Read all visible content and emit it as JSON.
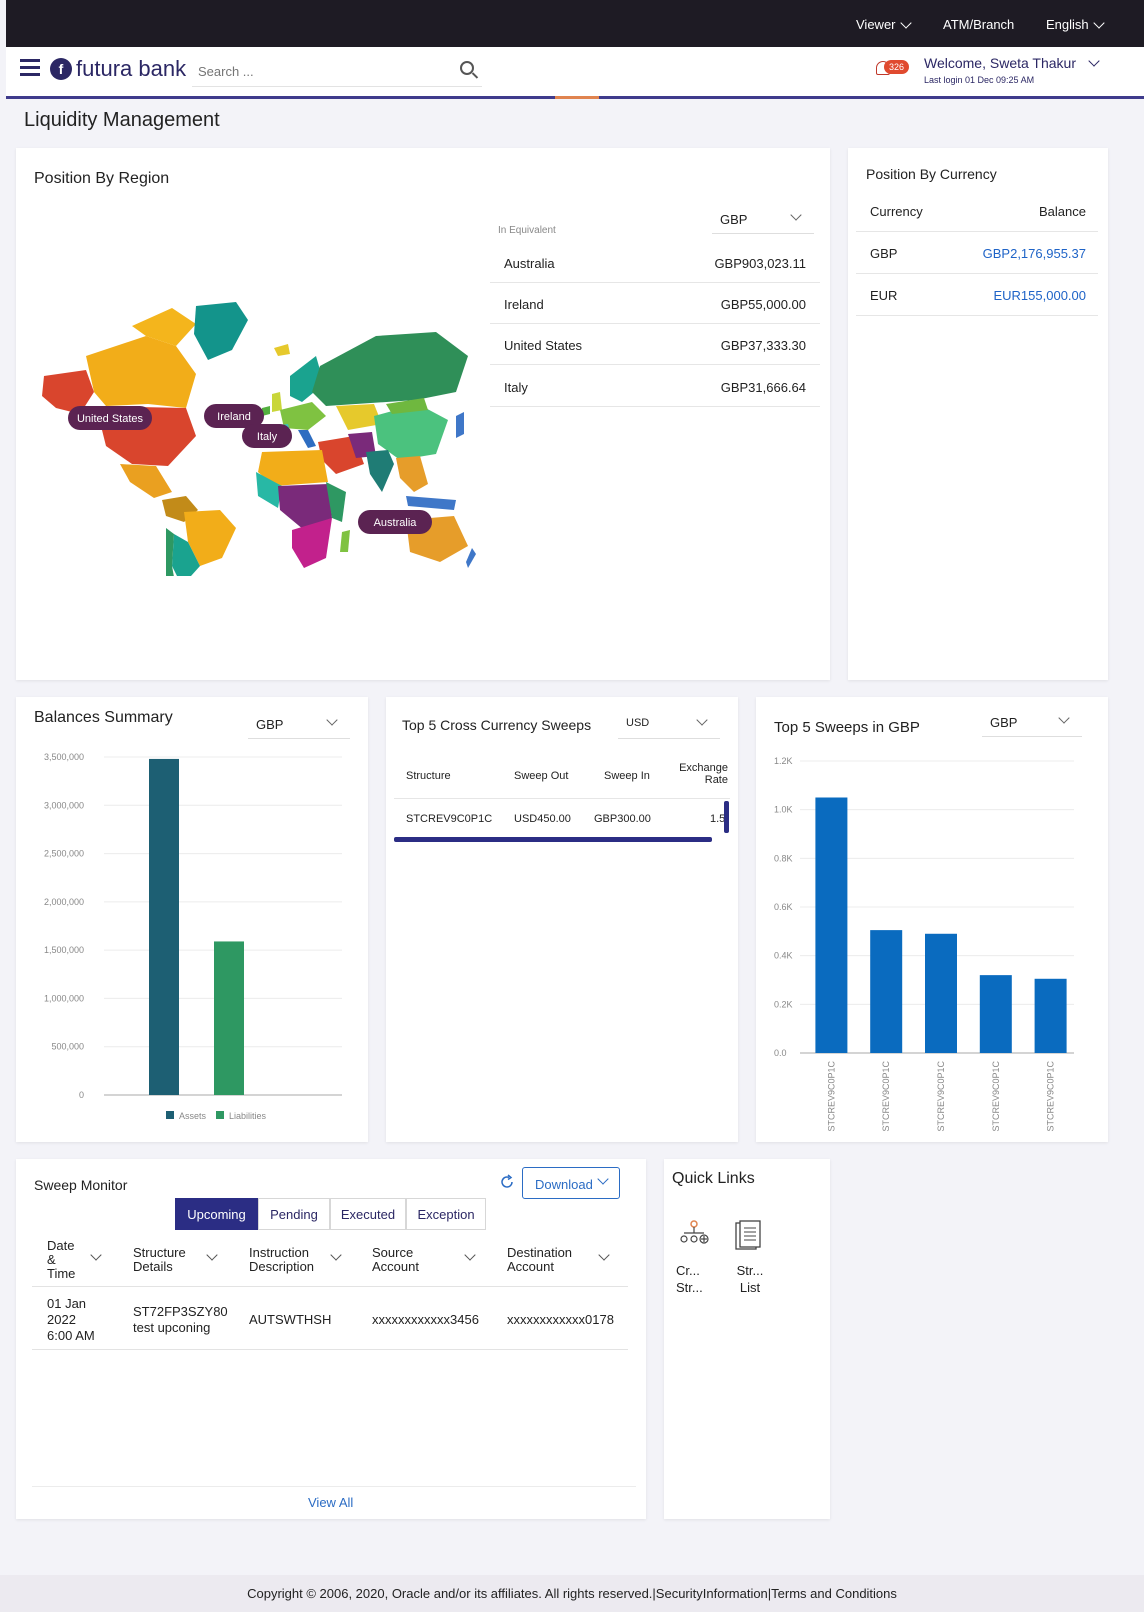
{
  "topbar": {
    "viewer": "Viewer",
    "atm_branch": "ATM/Branch",
    "language": "English"
  },
  "header": {
    "brand": "futura bank",
    "search_placeholder": "Search ...",
    "notification_count": "326",
    "welcome": "Welcome, Sweta Thakur",
    "last_login": "Last login 01 Dec 09:25 AM"
  },
  "page_title": "Liquidity Management",
  "position_by_region": {
    "title": "Position By Region",
    "in_equivalent": "In Equivalent",
    "currency": "GBP",
    "map_labels": [
      "United States",
      "Ireland",
      "Italy",
      "Australia"
    ],
    "rows": [
      {
        "region": "Australia",
        "amount": "GBP903,023.11"
      },
      {
        "region": "Ireland",
        "amount": "GBP55,000.00"
      },
      {
        "region": "United States",
        "amount": "GBP37,333.30"
      },
      {
        "region": "Italy",
        "amount": "GBP31,666.64"
      }
    ]
  },
  "position_by_currency": {
    "title": "Position By Currency",
    "col_currency": "Currency",
    "col_balance": "Balance",
    "rows": [
      {
        "currency": "GBP",
        "balance": "GBP2,176,955.37"
      },
      {
        "currency": "EUR",
        "balance": "EUR155,000.00"
      }
    ]
  },
  "balances_summary": {
    "title": "Balances Summary",
    "currency": "GBP",
    "chart_data": {
      "type": "bar",
      "categories": [
        "Assets",
        "Liabilities"
      ],
      "values": [
        3480000,
        1590000
      ],
      "yticks": [
        "0",
        "500,000",
        "1,000,000",
        "1,500,000",
        "2,000,000",
        "2,500,000",
        "3,000,000",
        "3,500,000"
      ],
      "ylim": [
        0,
        3500000
      ],
      "legend": [
        "Assets",
        "Liabilities"
      ],
      "colors": [
        "#1d5f73",
        "#2e9862"
      ],
      "legend_position": "bottom"
    }
  },
  "cross_currency": {
    "title": "Top 5 Cross Currency Sweeps",
    "currency": "USD",
    "headers": [
      "Structure",
      "Sweep Out",
      "Sweep In",
      "Exchange Rate"
    ],
    "rows": [
      {
        "structure": "STCREV9C0P1C",
        "sweep_out": "USD450.00",
        "sweep_in": "GBP300.00",
        "rate": "1.5"
      }
    ]
  },
  "top5_gbp": {
    "title": "Top 5 Sweeps in GBP",
    "currency": "GBP",
    "chart_data": {
      "type": "bar",
      "categories": [
        "STCREV9C0P1C",
        "STCREV9C0P1C",
        "STCREV9C0P1C",
        "STCREV9C0P1C",
        "STCREV9C0P1C"
      ],
      "values": [
        1050,
        505,
        490,
        320,
        305
      ],
      "yticks": [
        "0.0",
        "0.2K",
        "0.4K",
        "0.6K",
        "0.8K",
        "1.0K",
        "1.2K"
      ],
      "ylim": [
        0,
        1200
      ],
      "color": "#0a6bbf"
    }
  },
  "sweep_monitor": {
    "title": "Sweep Monitor",
    "download": "Download",
    "tabs": [
      "Upcoming",
      "Pending",
      "Executed",
      "Exception"
    ],
    "headers": {
      "date": "Date & Time",
      "structure": "Structure Details",
      "instruction": "Instruction Description",
      "source": "Source Account",
      "destination": "Destination Account"
    },
    "row": {
      "date": "01 Jan 2022 6:00 AM",
      "structure": "ST72FP3SZY80 test upconing",
      "instruction": "AUTSWTHSH",
      "source": "xxxxxxxxxxxx3456",
      "destination": "xxxxxxxxxxxx0178"
    },
    "view_all": "View All"
  },
  "quick_links": {
    "title": "Quick Links",
    "links": [
      {
        "label": "Cr... Str..."
      },
      {
        "label": "Str... List"
      }
    ]
  },
  "footer": "Copyright © 2006, 2020, Oracle and/or its affiliates. All rights reserved.|SecurityInformation|Terms and Conditions"
}
